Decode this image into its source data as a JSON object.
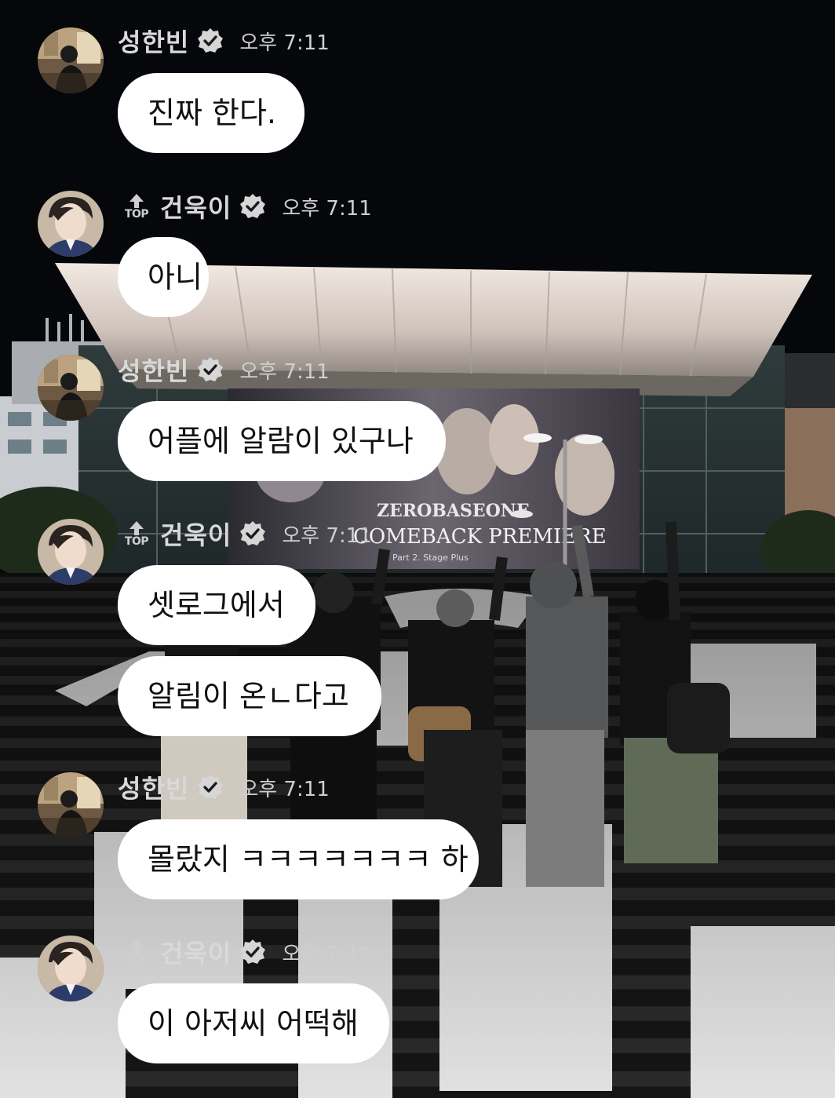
{
  "chat": {
    "messages": [
      {
        "sender": "성한빈",
        "avatar": "avatar-seonghanbin",
        "top_badge": false,
        "time": "오후 7:11",
        "lines": [
          "진짜 한다."
        ]
      },
      {
        "sender": "건욱이",
        "avatar": "avatar-geonuk",
        "top_badge": true,
        "top_label": "TOP",
        "time": "오후 7:11",
        "lines": [
          "아니"
        ]
      },
      {
        "sender": "성한빈",
        "avatar": "avatar-seonghanbin",
        "top_badge": false,
        "time": "오후 7:11",
        "lines": [
          "어플에 알람이 있구나"
        ]
      },
      {
        "sender": "건욱이",
        "avatar": "avatar-geonuk",
        "top_badge": true,
        "top_label": "TOP",
        "time": "오후 7:11",
        "lines": [
          "셋로그에서",
          "알림이 온ㄴ다고"
        ]
      },
      {
        "sender": "성한빈",
        "avatar": "avatar-seonghanbin",
        "top_badge": false,
        "time": "오후 7:11",
        "lines": [
          "몰랐지 ㅋㅋㅋㅋㅋㅋㅋ 하"
        ]
      },
      {
        "sender": "건욱이",
        "avatar": "avatar-geonuk",
        "top_badge": true,
        "top_label": "TOP",
        "time": "오후 7:11",
        "lines": [
          "이 아저씨 어떡해"
        ]
      }
    ]
  },
  "background": {
    "banner_group": "ZEROBASEONE",
    "banner_title": "COMEBACK PREMIERE",
    "banner_subtitle": "Part 2. Stage Plus"
  },
  "icons": {
    "verified": "verified-check-icon",
    "top": "top-arrow-icon"
  },
  "colors": {
    "bubble": "#ffffff",
    "bubble_text": "#111111",
    "header_text": "#d9d9d9",
    "night_sky": "#05070b"
  }
}
